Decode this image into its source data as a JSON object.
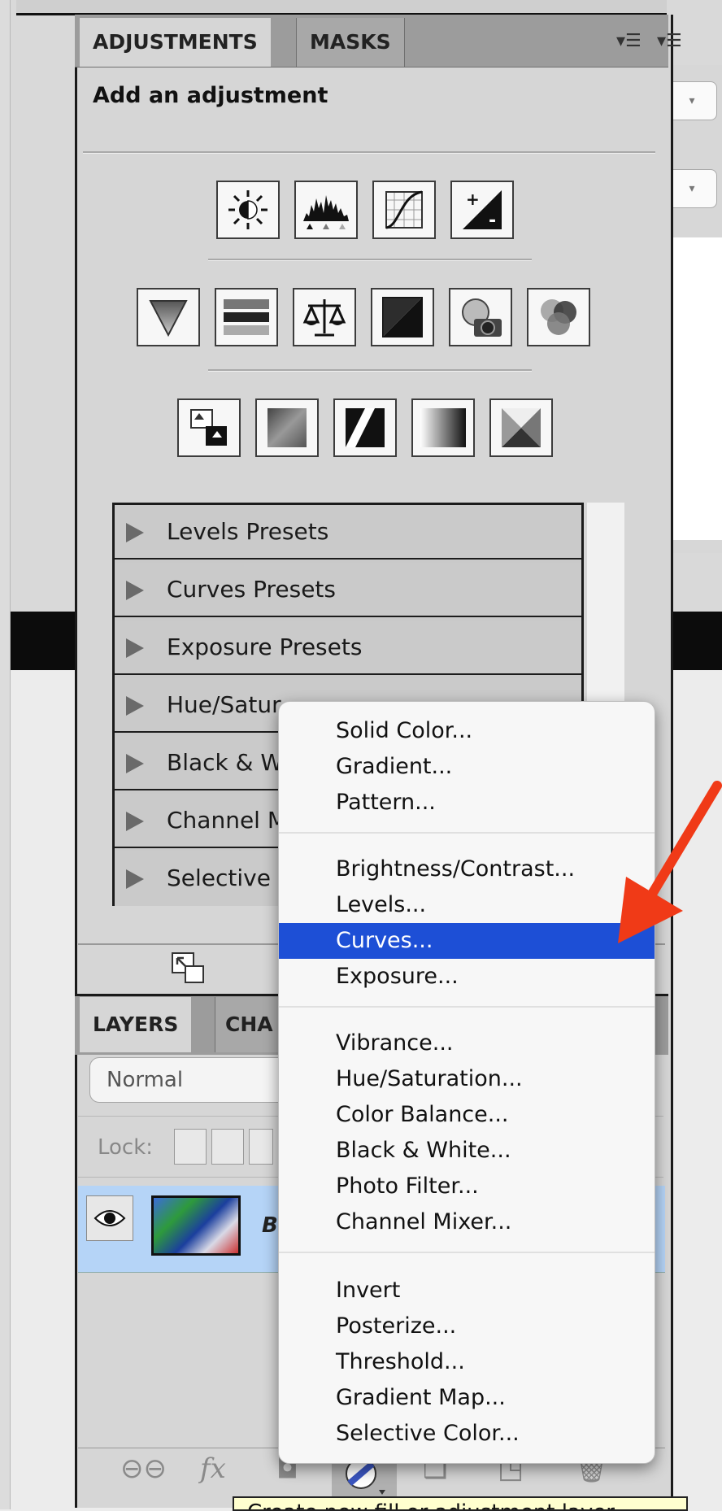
{
  "adjustments_panel": {
    "tabs": [
      {
        "label": "ADJUSTMENTS",
        "active": true
      },
      {
        "label": "MASKS",
        "active": false
      }
    ],
    "heading": "Add an adjustment",
    "icon_rows": [
      [
        "brightness-contrast-icon",
        "levels-icon",
        "curves-icon",
        "exposure-icon"
      ],
      [
        "vibrance-icon",
        "hue-saturation-icon",
        "color-balance-icon",
        "black-white-icon",
        "photo-filter-icon",
        "channel-mixer-icon"
      ],
      [
        "invert-icon",
        "posterize-icon",
        "threshold-icon",
        "gradient-map-icon",
        "selective-color-icon"
      ]
    ],
    "presets": [
      "Levels Presets",
      "Curves Presets",
      "Exposure Presets",
      "Hue/Satur",
      "Black & W",
      "Channel M",
      "Selective"
    ]
  },
  "layers_panel": {
    "tabs": [
      {
        "label": "LAYERS",
        "active": true
      },
      {
        "label": "CHA",
        "active": false
      }
    ],
    "blend_mode": "Normal",
    "lock_label": "Lock:",
    "layer_name": "B"
  },
  "adjustment_menu": {
    "groups": [
      [
        "Solid Color...",
        "Gradient...",
        "Pattern..."
      ],
      [
        "Brightness/Contrast...",
        "Levels...",
        "Curves...",
        "Exposure..."
      ],
      [
        "Vibrance...",
        "Hue/Saturation...",
        "Color Balance...",
        "Black & White...",
        "Photo Filter...",
        "Channel Mixer..."
      ],
      [
        "Invert",
        "Posterize...",
        "Threshold...",
        "Gradient Map...",
        "Selective Color..."
      ]
    ],
    "highlighted": "Curves...",
    "highlight_color": "#1d4fd6"
  },
  "tooltip": {
    "text": "Create new fill or adjustment layer"
  },
  "footer_icons": [
    "link-layers-icon",
    "fx-icon",
    "mask-icon",
    "adjustment-layer-icon",
    "group-icon",
    "new-layer-icon",
    "trash-icon"
  ],
  "colors": {
    "arrow": "#f03a17",
    "layer_selected": "#b5d4f7"
  }
}
